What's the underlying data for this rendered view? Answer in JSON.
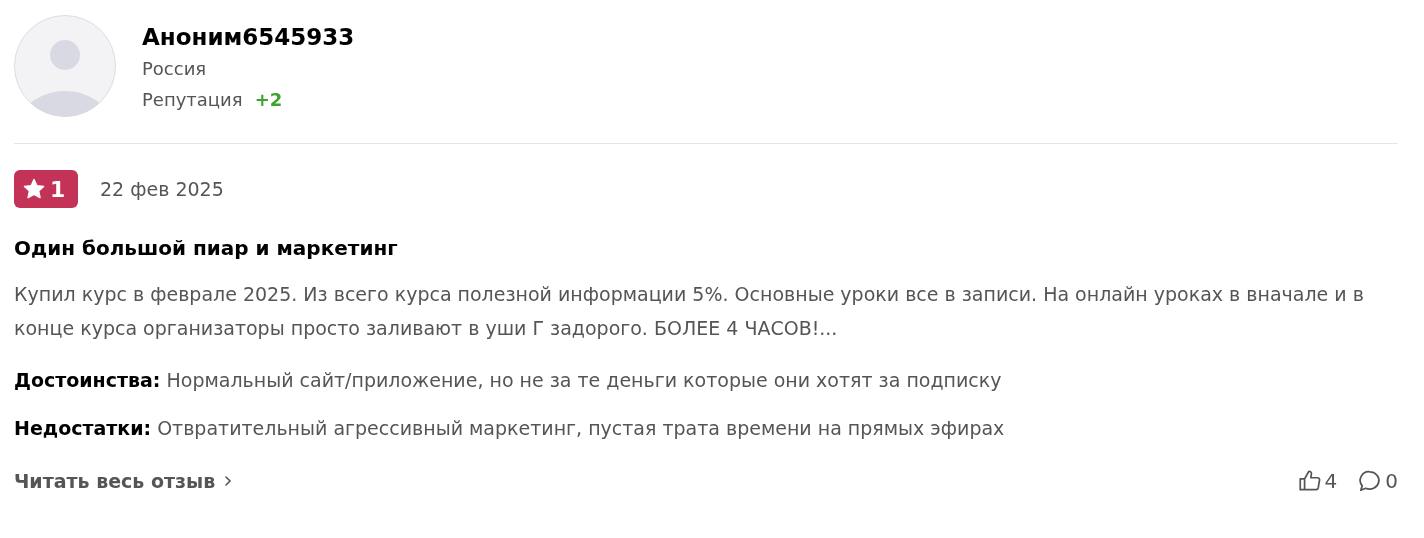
{
  "author": {
    "name": "Аноним6545933",
    "country": "Россия",
    "reputation_label": "Репутация",
    "reputation_value": "+2"
  },
  "review": {
    "rating": "1",
    "date": "22 фев 2025",
    "title": "Один большой пиар и маркетинг",
    "text": "Купил курс в феврале 2025. Из всего курса полезной информации 5%. Основные уроки все в записи. На онлайн уроках в вначале и в конце курса организаторы просто заливают в уши Г задорого. БОЛЕЕ 4 ЧАСОВ!...",
    "sections": [
      {
        "label": "Достоинства:",
        "text": "Нормальный сайт/приложение, но не за те деньги которые они хотят за подписку"
      },
      {
        "label": "Недостатки:",
        "text": "Отвратительный агрессивный маркетинг, пустая трата времени на прямых эфирах"
      }
    ]
  },
  "footer": {
    "read_more": "Читать весь отзыв",
    "likes": "4",
    "comments": "0"
  }
}
